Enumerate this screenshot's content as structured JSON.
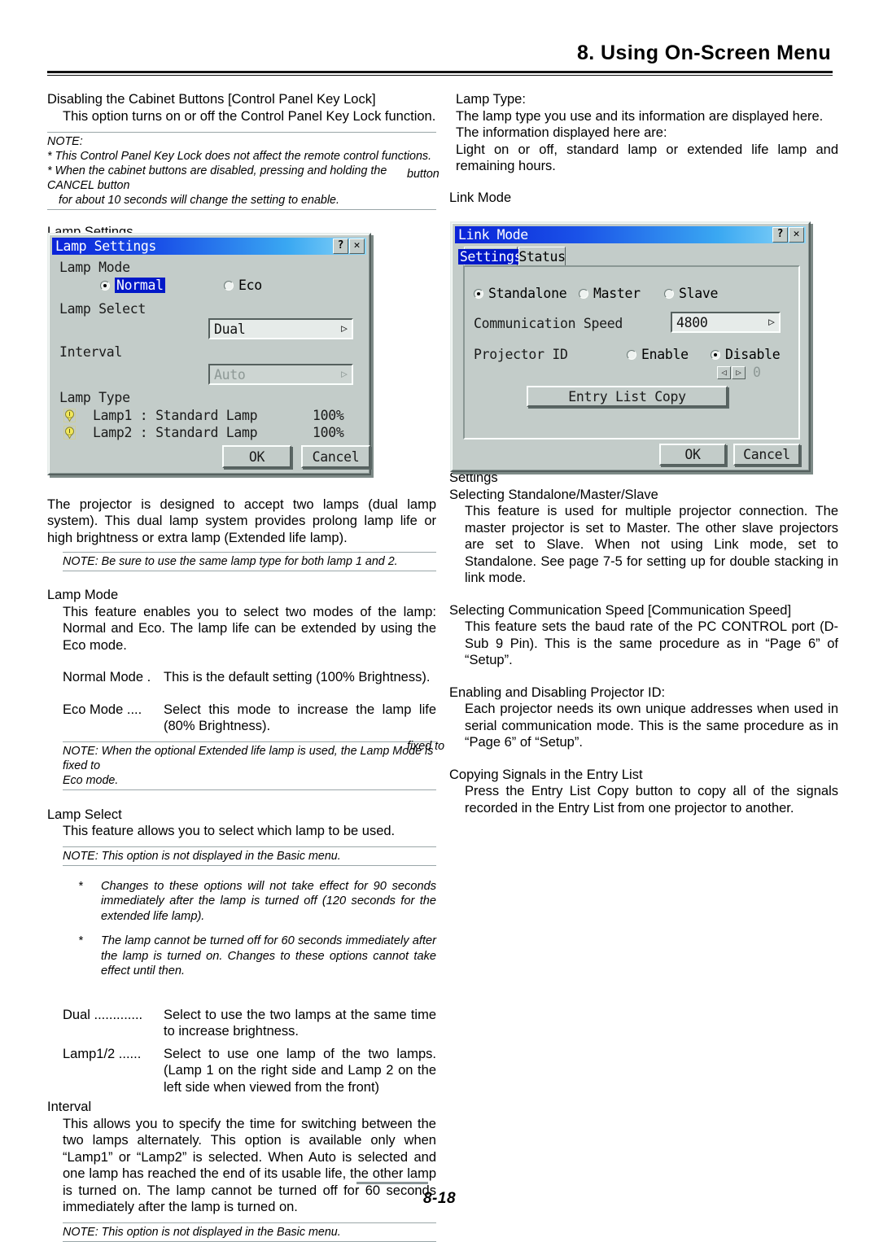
{
  "header": {
    "chapter_title": "8. Using On-Screen Menu"
  },
  "footer": {
    "page_number": "8-18"
  },
  "left_column": {
    "section1_heading": "Disabling the Cabinet Buttons [Control Panel Key Lock]",
    "section1_body": "This option turns on or off the Control Panel Key Lock function.",
    "note1_title": "NOTE:",
    "note1_line1": "* This Control Panel Key Lock does not affect the remote control functions.",
    "note1_line2": "* When the cabinet buttons are disabled, pressing and holding the CANCEL button",
    "note1_line3": "for about 10 seconds will change the setting to enable.",
    "lamp_settings_heading": "Lamp Settings",
    "para_dual_lamp": "The projector is designed to accept two lamps (dual lamp system). This dual lamp system provides prolong lamp life or high brightness or extra lamp (Extended life lamp).",
    "note2": "NOTE: Be sure to use the same lamp type for both lamp 1 and 2.",
    "lamp_mode_heading": "Lamp Mode",
    "lamp_mode_body": "This feature enables you to select two modes of the lamp: Normal and Eco. The lamp life can be extended by using the Eco mode.",
    "normal_mode_term": "Normal Mode .",
    "normal_mode_desc": "This is the default setting (100% Brightness).",
    "eco_mode_term": "Eco Mode ....",
    "eco_mode_desc": "Select this mode to increase the lamp life (80% Brightness).",
    "note3_line1": "NOTE: When the optional Extended life lamp is used, the Lamp Mode is fixed to",
    "note3_line2": "Eco mode.",
    "lamp_select_heading": "Lamp Select",
    "lamp_select_body": "This feature allows you to select which lamp to be used.",
    "note4": "NOTE: This option is not displayed in the Basic menu.",
    "star_bullet_marker": "*",
    "star1": "Changes to these options will not take effect for 90 seconds immediately after the lamp is turned off (120 seconds for the extended life lamp).",
    "star2": "The lamp cannot be turned off for 60 seconds immediately after the lamp is turned on. Changes to these options cannot take effect until then.",
    "dual_term": "Dual .............",
    "dual_desc": "Select to use the two lamps at the same time to increase brightness.",
    "lamp12_term": "Lamp1/2 ......",
    "lamp12_desc": "Select to use one lamp of the two lamps. (Lamp 1 on the right side and Lamp 2 on the left side when viewed from the front)",
    "interval_heading": "Interval",
    "interval_body": "This allows you to specify the time for switching between the two lamps alternately. This option is available only when “Lamp1” or “Lamp2” is selected. When Auto is selected and one lamp has reached the end of its usable life, the other lamp is turned on. The lamp cannot be turned off for 60 seconds immediately after the lamp is turned on.",
    "note5": "NOTE: This option is not displayed in the Basic menu."
  },
  "right_column": {
    "lamp_type_heading": "Lamp Type:",
    "lamp_type_line1": "The lamp type you use and its information are displayed here.",
    "lamp_type_line2": "The information displayed here are:",
    "lamp_type_line3": "Light on or off, standard lamp or extended life lamp and remaining hours.",
    "link_mode_heading": "Link Mode",
    "settings_heading": "Settings",
    "standalone_heading": "Selecting Standalone/Master/Slave",
    "standalone_body": "This feature is used for multiple projector connection. The master projector is set to Master. The other slave projectors are set to Slave. When not using Link mode, set to Standalone. See page 7-5 for setting up for double stacking in link mode.",
    "commspeed_heading": "Selecting Communication Speed [Communication Speed]",
    "commspeed_body": "This feature sets the baud rate of the PC CONTROL port (D-Sub 9 Pin). This is the same procedure as in “Page 6” of “Setup”.",
    "projid_heading": "Enabling and Disabling Projector ID:",
    "projid_body": "Each projector needs its own unique addresses when used in serial communication mode. This is the same procedure as in “Page 6” of “Setup”.",
    "entrylist_heading": "Copying Signals in the Entry List",
    "entrylist_body": "Press the Entry List Copy button to copy all of the signals recorded in the Entry List from one projector to another."
  },
  "lamp_settings_dialog": {
    "title": "Lamp Settings",
    "help_button": "?",
    "close_button": "✕",
    "lamp_mode_label": "Lamp Mode",
    "radio_normal": "Normal",
    "radio_eco": "Eco",
    "lamp_select_label": "Lamp Select",
    "lamp_select_value": "Dual",
    "interval_label": "Interval",
    "interval_value": "Auto",
    "lamp_type_label": "Lamp Type",
    "lamp1_label": "Lamp1 : Standard Lamp",
    "lamp1_value": "100%",
    "lamp2_label": "Lamp2 : Standard Lamp",
    "lamp2_value": "100%",
    "ok_button": "OK",
    "cancel_button": "Cancel",
    "dropdown_arrow": "▷"
  },
  "link_mode_dialog": {
    "title": "Link Mode",
    "help_button": "?",
    "close_button": "✕",
    "tab_settings": "Settings",
    "tab_status": "Status",
    "radio_standalone": "Standalone",
    "radio_master": "Master",
    "radio_slave": "Slave",
    "comm_speed_label": "Communication Speed",
    "comm_speed_value": "4800",
    "projector_id_label": "Projector ID",
    "radio_enable": "Enable",
    "radio_disable": "Disable",
    "spin_left": "◁",
    "spin_right": "▷",
    "spin_value": "0",
    "entry_list_copy_button": "Entry List Copy",
    "ok_button": "OK",
    "cancel_button": "Cancel",
    "dropdown_arrow": "▷"
  },
  "colors": {
    "dialog_face": "#c3ccc9",
    "titlebar_start": "#0a22d8",
    "titlebar_end": "#8fd8f8",
    "selection_blue": "#0018c8",
    "lamp_icon_yellow": "#f2e85a"
  }
}
